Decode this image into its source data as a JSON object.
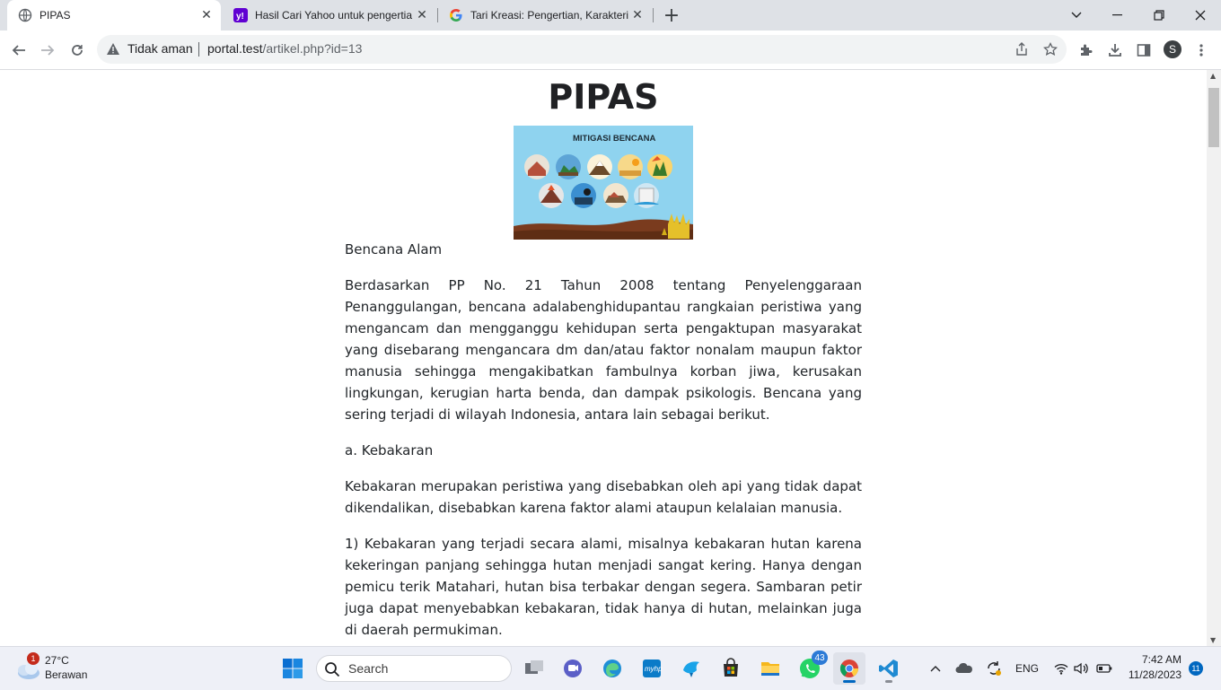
{
  "browser": {
    "tabs": [
      {
        "title": "PIPAS",
        "icon": "globe-icon",
        "active": true
      },
      {
        "title": "Hasil Cari Yahoo untuk pengertia",
        "icon": "yahoo-icon",
        "active": false
      },
      {
        "title": "Tari Kreasi: Pengertian, Karakteris",
        "icon": "google-icon",
        "active": false
      }
    ],
    "security_label": "Tidak aman",
    "url_host": "portal.test",
    "url_path": "/artikel.php?id=13",
    "profile_initial": "S"
  },
  "page": {
    "heading": "PIPAS",
    "image_title": "MITIGASI BENCANA",
    "paragraphs": [
      "Bencana Alam",
      "Berdasarkan PP No. 21 Tahun 2008 tentang Penyelenggaraan Penanggulangan, bencana adalabenghidupantau rangkaian peristiwa yang mengancam dan mengganggu kehidupan serta pengaktupan masyarakat yang disebarang mengancara dm dan/atau faktor nonalam maupun faktor manusia sehingga mengakibatkan fambulnya korban jiwa, kerusakan lingkungan, kerugian harta benda, dan dampak psikologis. Bencana yang sering terjadi di wilayah Indonesia, antara lain sebagai berikut.",
      "a. Kebakaran",
      "Kebakaran merupakan peristiwa yang disebabkan oleh api yang tidak dapat dikendalikan, disebabkan karena faktor alami ataupun kelalaian manusia.",
      "1) Kebakaran yang terjadi secara alami, misalnya kebakaran hutan karena kekeringan panjang sehingga hutan menjadi sangat kering. Hanya dengan pemicu terik Matahari, hutan bisa terbakar dengan segera. Sambaran petir juga dapat menyebabkan kebakaran, tidak hanya di hutan, melainkan juga di daerah permukiman."
    ]
  },
  "taskbar": {
    "weather_temp": "27°C",
    "weather_cond": "Berawan",
    "weather_badge": "1",
    "search_placeholder": "Search",
    "whatsapp_badge": "43",
    "lang": "ENG",
    "time": "7:42 AM",
    "date": "11/28/2023",
    "notif_count": "11"
  },
  "colors": {
    "tabbar_bg": "#dee1e6",
    "taskbar_bg": "#eef0f7",
    "image_sky": "#8fd3ef"
  }
}
